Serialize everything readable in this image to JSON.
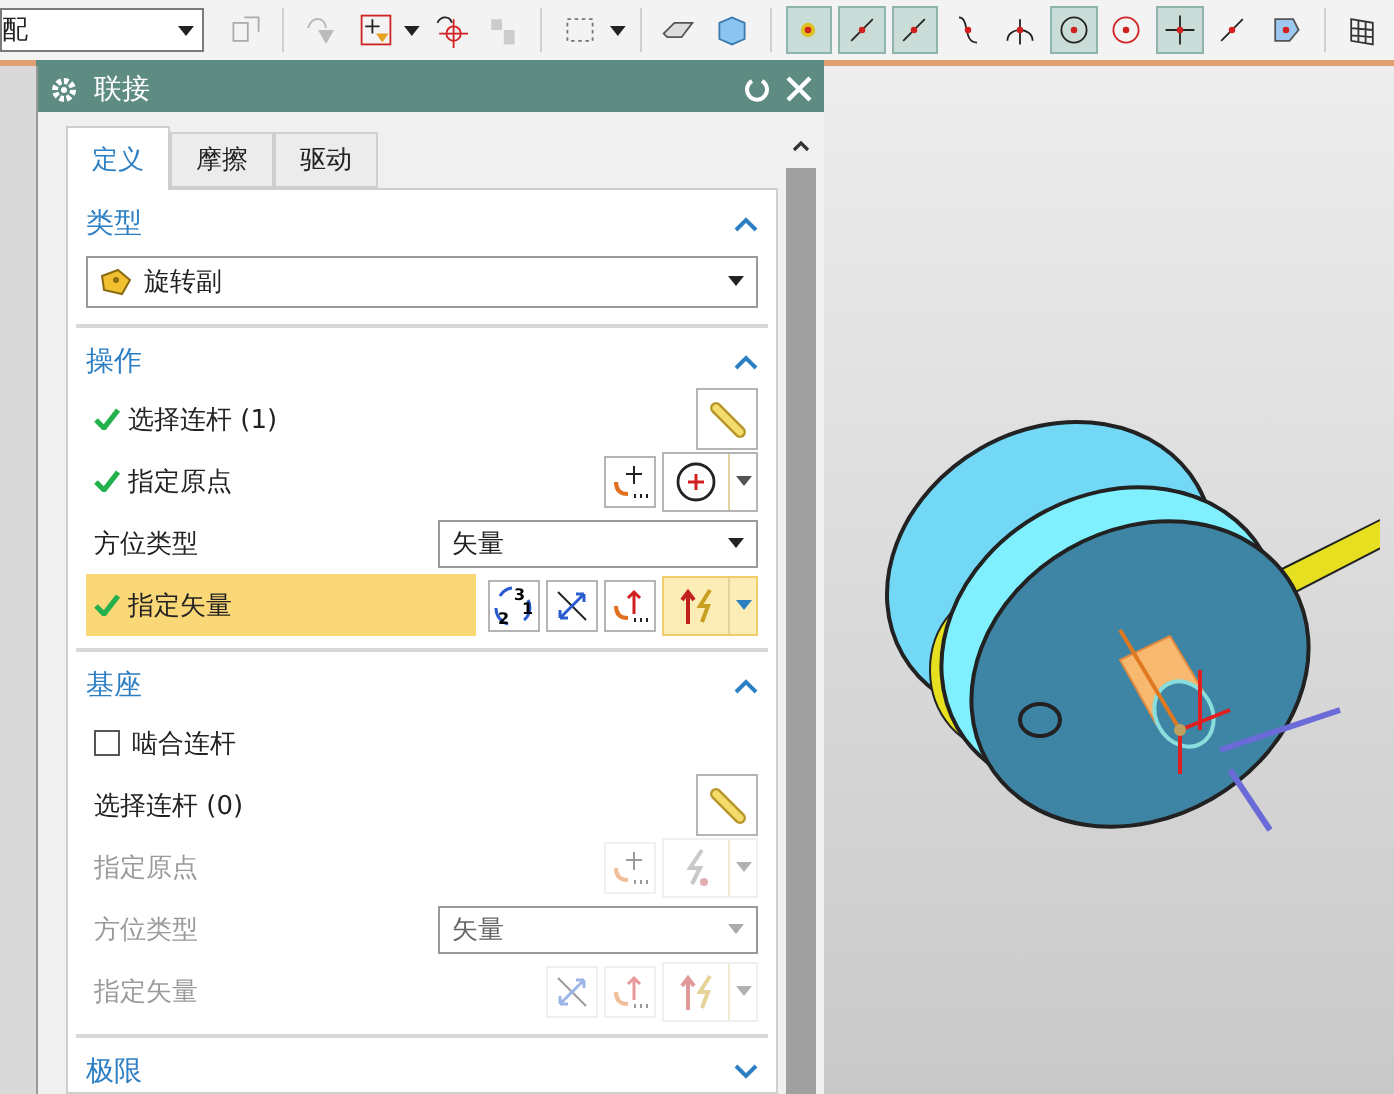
{
  "toolbar": {
    "dropdown": "配",
    "snap_buttons": [
      {
        "selected": true
      },
      {
        "selected": true
      },
      {
        "selected": true
      },
      {
        "selected": false
      },
      {
        "selected": false
      },
      {
        "selected": true
      },
      {
        "selected": false
      },
      {
        "selected": true
      },
      {
        "selected": false
      },
      {
        "selected": false
      }
    ]
  },
  "dialog": {
    "title": "联接",
    "tabs": [
      {
        "label": "定义",
        "selected": true
      },
      {
        "label": "摩擦",
        "selected": false
      },
      {
        "label": "驱动",
        "selected": false
      }
    ],
    "sections": [
      {
        "title": "类型",
        "expanded": true,
        "rows": [
          {
            "kind": "type_select",
            "value": "旋转副"
          }
        ]
      },
      {
        "title": "操作",
        "expanded": true,
        "rows": [
          {
            "kind": "picker",
            "label": "选择连杆 (1)",
            "done": true,
            "disabled": false,
            "highlighted": false,
            "tools": [
              {
                "kind": "link"
              }
            ]
          },
          {
            "kind": "picker",
            "label": "指定原点",
            "done": true,
            "disabled": false,
            "highlighted": false,
            "tools": [
              {
                "kind": "point_dialog"
              },
              {
                "kind": "point_menu"
              }
            ]
          },
          {
            "kind": "option",
            "label": "方位类型",
            "value": "矢量",
            "disabled": false
          },
          {
            "kind": "picker",
            "label": "指定矢量",
            "done": true,
            "disabled": false,
            "highlighted": true,
            "tools": [
              {
                "kind": "cycle",
                "digits": [
                  "3",
                  "1",
                  "2"
                ]
              },
              {
                "kind": "reverse"
              },
              {
                "kind": "vector_dialog"
              },
              {
                "kind": "vector_menu"
              }
            ]
          }
        ]
      },
      {
        "title": "基座",
        "expanded": true,
        "rows": [
          {
            "kind": "checkbox",
            "label": "啮合连杆",
            "checked": false
          },
          {
            "kind": "picker",
            "label": "选择连杆 (0)",
            "done": false,
            "disabled": false,
            "highlighted": false,
            "tools": [
              {
                "kind": "link"
              }
            ]
          },
          {
            "kind": "picker",
            "label": "指定原点",
            "done": false,
            "disabled": true,
            "highlighted": false,
            "tools": [
              {
                "kind": "point_dialog"
              },
              {
                "kind": "inferred_menu"
              }
            ]
          },
          {
            "kind": "option",
            "label": "方位类型",
            "value": "矢量",
            "disabled": true
          },
          {
            "kind": "picker",
            "label": "指定矢量",
            "done": false,
            "disabled": true,
            "highlighted": false,
            "tools": [
              {
                "kind": "reverse"
              },
              {
                "kind": "vector_dialog"
              },
              {
                "kind": "vector_menu"
              }
            ]
          }
        ]
      },
      {
        "title": "极限",
        "expanded": false
      }
    ]
  }
}
